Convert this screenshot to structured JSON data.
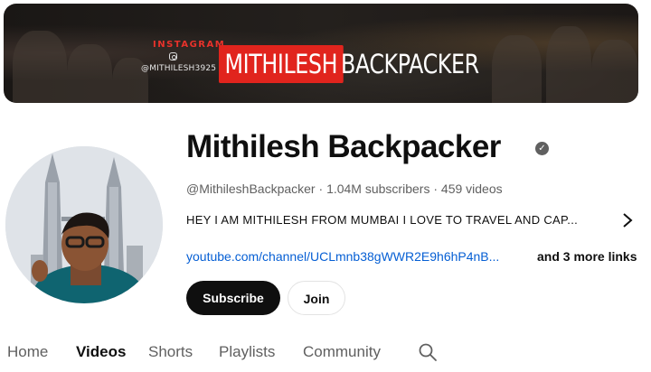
{
  "banner": {
    "instagram_label": "INSTAGRAM",
    "instagram_handle": "@MITHILESH3925",
    "brand_red_text": "MITHILESH",
    "brand_white_text": "BACKPACKER",
    "accent_red": "#e1241d"
  },
  "channel": {
    "name": "Mithilesh Backpacker",
    "verified_icon": "verified-check-icon",
    "handle": "@MithileshBackpacker",
    "subscribers": "1.04M subscribers",
    "videos": "459 videos",
    "separator": "·",
    "description": "HEY I AM MITHILESH FROM MUMBAI I LOVE TO TRAVEL AND CAP...",
    "link": "youtube.com/channel/UCLmnb38gWWR2E9h6hP4nB...",
    "more_links": "and 3 more links"
  },
  "actions": {
    "subscribe_label": "Subscribe",
    "join_label": "Join"
  },
  "tabs": [
    {
      "label": "Home",
      "active": false
    },
    {
      "label": "Videos",
      "active": true
    },
    {
      "label": "Shorts",
      "active": false
    },
    {
      "label": "Playlists",
      "active": false
    },
    {
      "label": "Community",
      "active": false
    }
  ],
  "icons": {
    "search": "search-icon",
    "chevron": "chevron-right-icon"
  },
  "colors": {
    "link_blue": "#065fd4",
    "subscribe_bg": "#0f0f0f",
    "muted_text": "#606060"
  }
}
